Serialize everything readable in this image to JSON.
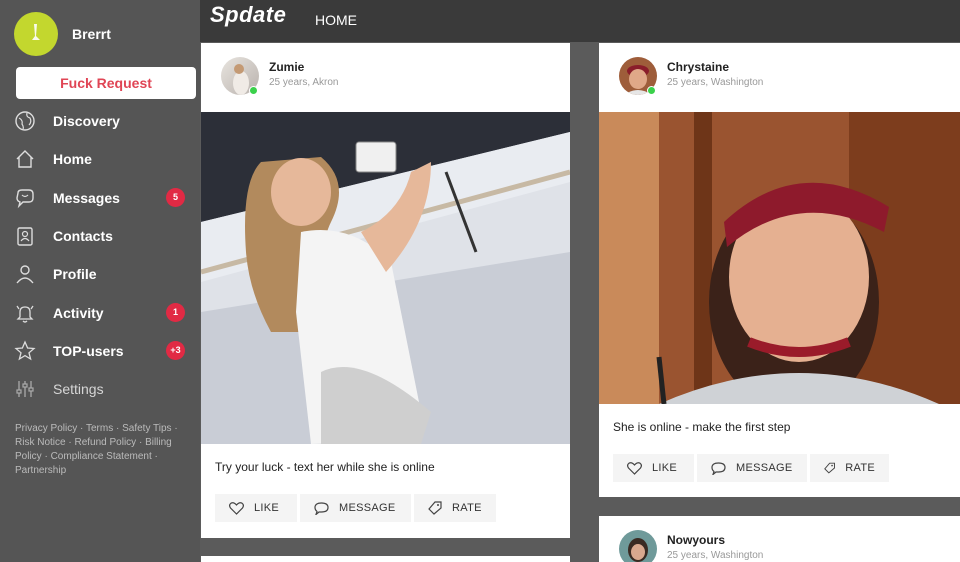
{
  "app": {
    "logo": "Spdate",
    "nav_home": "HOME"
  },
  "user": {
    "name": "Brerrt"
  },
  "request_button": "Fuck Request",
  "sidebar": {
    "items": [
      {
        "label": "Discovery",
        "icon": "globe-icon",
        "badge": ""
      },
      {
        "label": "Home",
        "icon": "home-icon",
        "badge": ""
      },
      {
        "label": "Messages",
        "icon": "chat-icon",
        "badge": "5"
      },
      {
        "label": "Contacts",
        "icon": "contacts-icon",
        "badge": ""
      },
      {
        "label": "Profile",
        "icon": "user-icon",
        "badge": ""
      },
      {
        "label": "Activity",
        "icon": "bell-icon",
        "badge": "1"
      },
      {
        "label": "TOP-users",
        "icon": "star-icon",
        "badge": "+3"
      },
      {
        "label": "Settings",
        "icon": "sliders-icon",
        "badge": ""
      }
    ]
  },
  "footer_links": [
    "Privacy Policy",
    "Terms",
    "Safety Tips",
    "Risk Notice",
    "Refund Policy",
    "Billing Policy",
    "Compliance Statement",
    "Partnership"
  ],
  "cards": [
    {
      "name": "Zumie",
      "meta": "25 years, Akron",
      "caption": "Try your luck - text her while she is online",
      "like": "LIKE",
      "message": "MESSAGE",
      "rate": "RATE"
    },
    {
      "name": "Chrystaine",
      "meta": "25 years, Washington",
      "caption": "She is online - make the first step",
      "like": "LIKE",
      "message": "MESSAGE",
      "rate": "RATE"
    },
    {
      "name": "Nowyours",
      "meta": "25 years, Washington"
    }
  ],
  "colors": {
    "accent": "#e12a44",
    "avatar": "#c3d72e",
    "online": "#3ad14b"
  }
}
